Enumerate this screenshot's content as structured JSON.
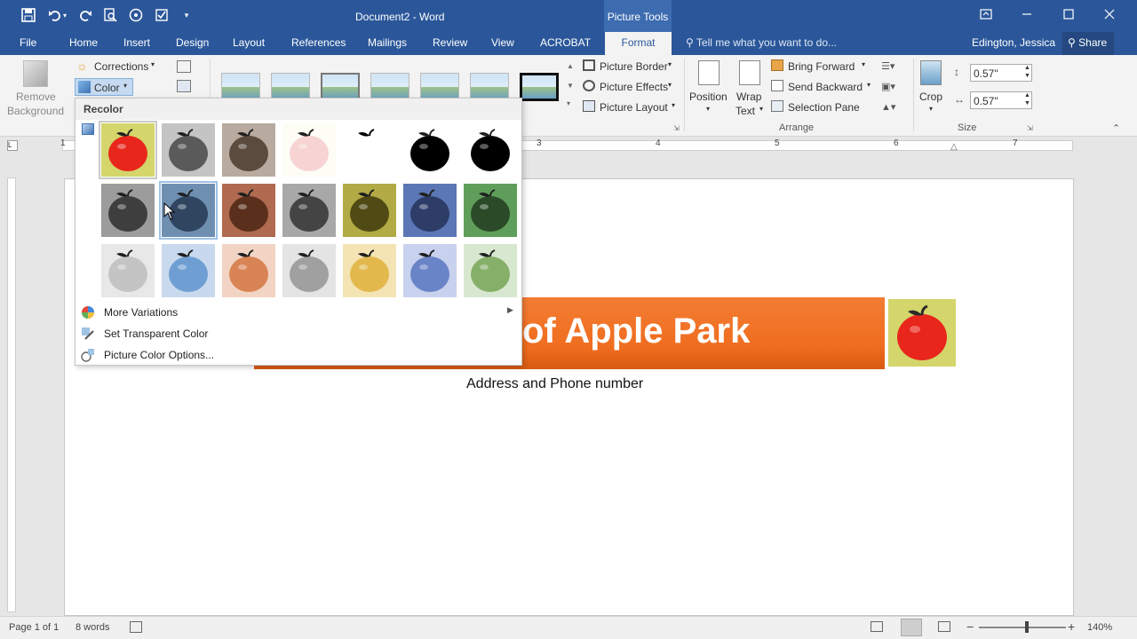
{
  "window": {
    "title": "Document2 - Word",
    "context_tab_group": "Picture Tools"
  },
  "tabs": [
    "File",
    "Home",
    "Insert",
    "Design",
    "Layout",
    "References",
    "Mailings",
    "Review",
    "View",
    "ACROBAT"
  ],
  "active_tab": "Format",
  "tell_me": "Tell me what you want to do...",
  "user": "Edington, Jessica",
  "share": "Share",
  "ribbon": {
    "remove_background_line1": "Remove",
    "remove_background_line2": "Background",
    "corrections": "Corrections",
    "color": "Color",
    "picture_border": "Picture Border",
    "picture_effects": "Picture Effects",
    "picture_layout": "Picture Layout",
    "position": "Position",
    "wrap_text_line1": "Wrap",
    "wrap_text_line2": "Text",
    "bring_forward": "Bring Forward",
    "send_backward": "Send Backward",
    "selection_pane": "Selection Pane",
    "crop": "Crop",
    "height": "0.57\"",
    "width": "0.57\"",
    "group_arrange": "Arrange",
    "group_size": "Size"
  },
  "ruler": [
    "1",
    "3",
    "4",
    "5",
    "6",
    "7"
  ],
  "recolor_menu": {
    "header": "Recolor",
    "swatches": [
      {
        "bg": "#d4d56a",
        "apple": "#e8261c"
      },
      {
        "bg": "#c4c4c4",
        "apple": "#5a5a5a"
      },
      {
        "bg": "#b8aa9e",
        "apple": "#5b4a3e"
      },
      {
        "bg": "#fdfdf6",
        "apple": "#f7d3d3"
      },
      {
        "bg": "#ffffff",
        "apple": "#ffffff"
      },
      {
        "bg": "#ffffff",
        "apple": "#000000"
      },
      {
        "bg": "#ffffff",
        "apple": "#000000"
      },
      {
        "bg": "#9c9c9c",
        "apple": "#3e3e3e"
      },
      {
        "bg": "#6f8fb1",
        "apple": "#2f4560"
      },
      {
        "bg": "#b06a4f",
        "apple": "#5a2f1c"
      },
      {
        "bg": "#a8a8a8",
        "apple": "#444444"
      },
      {
        "bg": "#b2aa44",
        "apple": "#504a14"
      },
      {
        "bg": "#5b77b5",
        "apple": "#2d3d68"
      },
      {
        "bg": "#5f9e5a",
        "apple": "#2a4a28"
      },
      {
        "bg": "#e8e8e8",
        "apple": "#c4c4c4"
      },
      {
        "bg": "#c8d9ee",
        "apple": "#6f9fd2"
      },
      {
        "bg": "#f1d4c4",
        "apple": "#d98454"
      },
      {
        "bg": "#e4e4e4",
        "apple": "#a0a0a0"
      },
      {
        "bg": "#f4e4b4",
        "apple": "#e3b84d"
      },
      {
        "bg": "#c8d2ee",
        "apple": "#6a84c8"
      },
      {
        "bg": "#d8e8d0",
        "apple": "#86b06a"
      }
    ],
    "more_variations": "More Variations",
    "set_transparent_color": "Set Transparent Color",
    "picture_color_options": "Picture Color Options..."
  },
  "document": {
    "banner_text": "of Apple Park",
    "address": "Address and Phone number"
  },
  "status": {
    "page": "Page 1 of 1",
    "words": "8 words",
    "zoom": "140%"
  },
  "colors": {
    "word_blue": "#2b579a",
    "banner_orange": "#f37d33"
  }
}
